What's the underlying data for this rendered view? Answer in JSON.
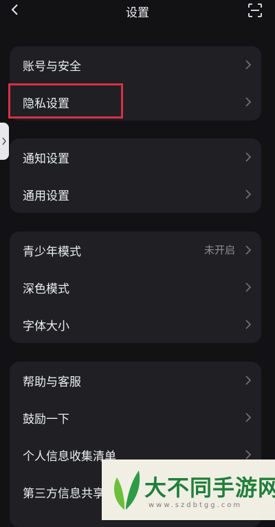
{
  "header": {
    "title": "设置"
  },
  "groups": [
    {
      "items": [
        {
          "label": "账号与安全"
        },
        {
          "label": "隐私设置"
        }
      ]
    },
    {
      "items": [
        {
          "label": "通知设置"
        },
        {
          "label": "通用设置"
        }
      ]
    },
    {
      "items": [
        {
          "label": "青少年模式",
          "value": "未开启"
        },
        {
          "label": "深色模式"
        },
        {
          "label": "字体大小"
        }
      ]
    },
    {
      "items": [
        {
          "label": "帮助与客服"
        },
        {
          "label": "鼓励一下"
        },
        {
          "label": "个人信息收集清单"
        },
        {
          "label": "第三方信息共享"
        }
      ]
    }
  ],
  "watermark": {
    "text": "大不同手游网",
    "url": "www.szdbtgg.com"
  },
  "colors": {
    "background": "#121214",
    "card": "#1f1f24",
    "highlight": "#d83047",
    "watermark_green": "#1f7f3a"
  }
}
